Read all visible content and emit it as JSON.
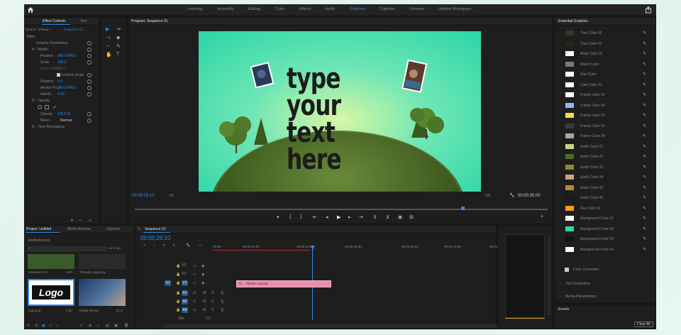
{
  "topbar": {
    "workspaces": [
      "Learning",
      "Assembly",
      "Editing",
      "Color",
      "Effects",
      "Audio",
      "Graphics",
      "Captions",
      "Libraries",
      "Untitled Workspace"
    ],
    "active_workspace": "Graphics"
  },
  "effect_controls": {
    "tabs": [
      "Effect Controls",
      "Text"
    ],
    "source": "Source * Please r...",
    "sequence": "Sequence 01 ...",
    "section_video": "Video",
    "rows": [
      {
        "label": "Graphic Parameters",
        "value": ""
      },
      {
        "label": "Motion",
        "value": ""
      },
      {
        "label": "Position",
        "value": "960.0   540.0"
      },
      {
        "label": "Scale",
        "value": "100.0"
      },
      {
        "label": "Scale Width",
        "value": "100.0"
      },
      {
        "label": "Uniform Scale",
        "value": ""
      },
      {
        "label": "Rotation",
        "value": "0.0"
      },
      {
        "label": "Anchor Po...",
        "value": "960.0   540.0"
      },
      {
        "label": "Anti-fli...",
        "value": "0.00"
      },
      {
        "label": "Opacity",
        "value": ""
      },
      {
        "label": "Opacity",
        "value": "100.0 %"
      },
      {
        "label": "Blend ...",
        "value": "Normal"
      },
      {
        "label": "Time Remapping",
        "value": ""
      }
    ],
    "timecode": "00:00:26:10"
  },
  "program": {
    "title": "Program: Sequence 01",
    "headline_line1": "type your",
    "headline_line2": "text here",
    "timecode": "00:00:26:10",
    "fit": "Fit",
    "quality": "1/4",
    "duration": "00:00:35:00"
  },
  "project": {
    "tabs": [
      "Project: Untitled",
      "Media Browser",
      "Libraries"
    ],
    "filename": "Untitled.prproj",
    "items_count": "1 of 4 ite...",
    "items": [
      {
        "name": "Sequence 01",
        "duration": "5:00"
      },
      {
        "name": "Triangle Logo.png",
        "duration": ""
      },
      {
        "name": "logo.png",
        "duration": "5:00"
      },
      {
        "name": "Media Stored",
        "duration": "14:17"
      }
    ],
    "logo_text": "Logo"
  },
  "timeline": {
    "tab": "Sequence 01",
    "timecode": "00:00:26:10",
    "ruler": [
      "00:00",
      "00:00:15:00",
      "00:00:30:00",
      "00:00:45:00",
      "00:01:00:00",
      "00:01:15:00",
      "00:01:30:00"
    ],
    "tracks": [
      "V3",
      "V2",
      "V1",
      "A1",
      "A2",
      "A3",
      "Mix"
    ],
    "mix_value": "0.0",
    "clip_label": "Please Journey"
  },
  "essential_graphics": {
    "title": "Essential Graphics",
    "colors": [
      {
        "name": "Tree Color 02",
        "hex": "#2d3b21"
      },
      {
        "name": "Tree Color 01",
        "hex": "#1f2a1a"
      },
      {
        "name": "Birds Color 01",
        "hex": "#ffffff"
      },
      {
        "name": "Warm Color",
        "hex": "#7a7a7a"
      },
      {
        "name": "Star Color",
        "hex": "#ffffff"
      },
      {
        "name": "Cam Color 01",
        "hex": "#ffffff"
      },
      {
        "name": "Frame Color 01",
        "hex": "#ffffff"
      },
      {
        "name": "Frame Color 04",
        "hex": "#8fb8f0"
      },
      {
        "name": "Frame Color 03",
        "hex": "#ffd84a"
      },
      {
        "name": "Frame Color 02",
        "hex": "#3a3a3a"
      },
      {
        "name": "Frame Color 04",
        "hex": "#a8a8a8"
      },
      {
        "name": "Earth Color 01",
        "hex": "#c9d27a"
      },
      {
        "name": "Earth Color 02",
        "hex": "#4a6b26"
      },
      {
        "name": "Earth Color 03",
        "hex": "#8a8a3a"
      },
      {
        "name": "Earth Color 04",
        "hex": "#c8a878"
      },
      {
        "name": "Earth Color 05",
        "hex": "#b88a2a"
      },
      {
        "name": "Earth Color 06",
        "hex": "#1a1a1a"
      },
      {
        "name": "Sky Color 01",
        "hex": "#ff9a1a"
      },
      {
        "name": "Background Color 01",
        "hex": "#ffffff"
      },
      {
        "name": "Background Color 02",
        "hex": "#33d6a8"
      },
      {
        "name": "Background Color 03",
        "hex": "#111111"
      },
      {
        "name": "Background Color 04",
        "hex": "#ffffff"
      }
    ],
    "color_correction": "Color Correction",
    "sections": [
      "Text Controllers",
      "Media Placeholders"
    ],
    "events_title": "Events",
    "clear_all": "Clear All"
  },
  "colors": {
    "accent": "#2d8ceb",
    "bg": "#1e1e1e",
    "monitor_bg": "#4de0b4",
    "clip": "#e88fa8"
  }
}
